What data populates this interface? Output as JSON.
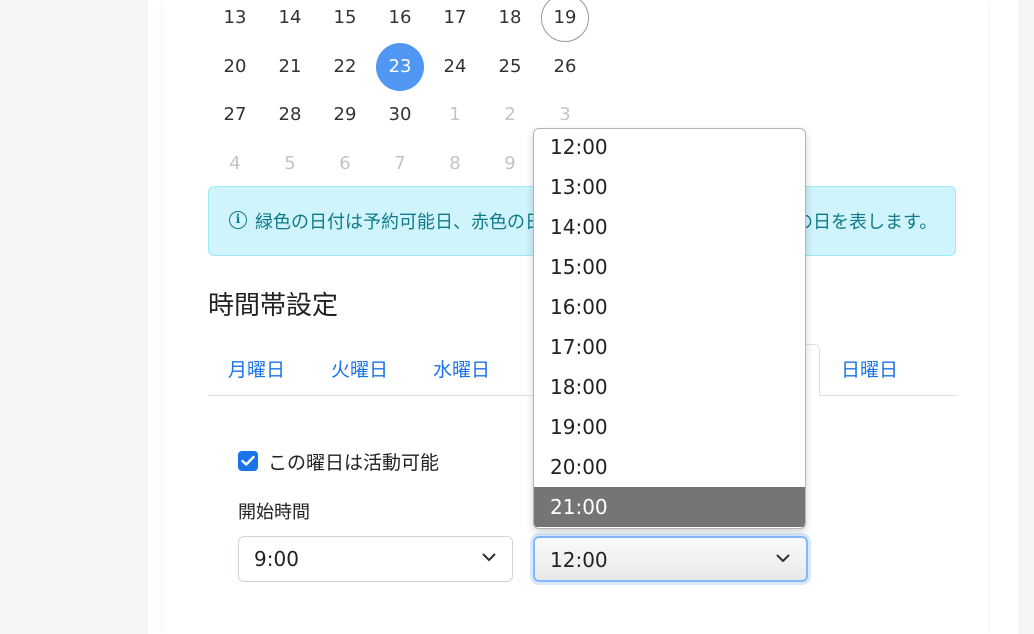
{
  "calendar": {
    "rows": [
      [
        {
          "d": "13"
        },
        {
          "d": "14"
        },
        {
          "d": "15"
        },
        {
          "d": "16"
        },
        {
          "d": "17"
        },
        {
          "d": "18"
        },
        {
          "d": "19",
          "state": "today"
        }
      ],
      [
        {
          "d": "20"
        },
        {
          "d": "21"
        },
        {
          "d": "22"
        },
        {
          "d": "23",
          "state": "selected"
        },
        {
          "d": "24"
        },
        {
          "d": "25"
        },
        {
          "d": "26"
        }
      ],
      [
        {
          "d": "27"
        },
        {
          "d": "28"
        },
        {
          "d": "29"
        },
        {
          "d": "30"
        },
        {
          "d": "1",
          "state": "muted"
        },
        {
          "d": "2",
          "state": "muted"
        },
        {
          "d": "3",
          "state": "muted"
        }
      ],
      [
        {
          "d": "4",
          "state": "muted"
        },
        {
          "d": "5",
          "state": "muted"
        },
        {
          "d": "6",
          "state": "muted"
        },
        {
          "d": "7",
          "state": "muted"
        },
        {
          "d": "8",
          "state": "muted"
        },
        {
          "d": "9",
          "state": "muted"
        }
      ]
    ]
  },
  "info": {
    "text": "緑色の日付は予約可能日、赤色の日付は予約不可日、青色は選択中の日を表します。",
    "icon": "info-circle-icon"
  },
  "section": {
    "title": "時間帯設定"
  },
  "tabs": [
    {
      "label": "月曜日"
    },
    {
      "label": "火曜日"
    },
    {
      "label": "水曜日"
    },
    {
      "label": "日曜日"
    }
  ],
  "form": {
    "active_checkbox_label": "この曜日は活動可能",
    "active_checked": true,
    "start_label": "開始時間",
    "start_value": "9:00",
    "end_value": "12:00"
  },
  "dropdown": {
    "options": [
      "12:00",
      "13:00",
      "14:00",
      "15:00",
      "16:00",
      "17:00",
      "18:00",
      "19:00",
      "20:00",
      "21:00"
    ],
    "highlighted": "21:00"
  },
  "colors": {
    "accent": "#1a73e8",
    "selected_day": "#4f97f3",
    "info_bg": "#cff4fc",
    "info_text": "#117a8b",
    "option_highlight": "#757575"
  }
}
